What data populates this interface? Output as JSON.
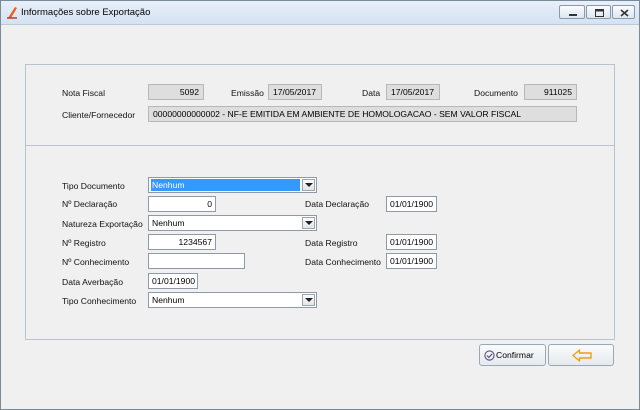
{
  "window": {
    "title": "Informações sobre Exportação",
    "controls": [
      "minimize-icon",
      "maximize-icon",
      "close-icon"
    ]
  },
  "invoice": {
    "nota_fiscal_label": "Nota Fiscal",
    "nota_fiscal_value": "5092",
    "emissao_label": "Emissão",
    "emissao_value": "17/05/2017",
    "data_label": "Data",
    "data_value": "17/05/2017",
    "documento_label": "Documento",
    "documento_value": "911025",
    "cliente_label": "Cliente/Fornecedor",
    "cliente_value": "00000000000002 - NF-E EMITIDA EM AMBIENTE DE HOMOLOGACAO - SEM VALOR FISCAL"
  },
  "export": {
    "tipo_documento_label": "Tipo Documento",
    "tipo_documento_value": "Nenhum",
    "num_declaracao_label": "Nº Declaração",
    "num_declaracao_value": "0",
    "data_declaracao_label": "Data Declaração",
    "data_declaracao_value": "01/01/1900",
    "natureza_label": "Natureza Exportação",
    "natureza_value": "Nenhum",
    "num_registro_label": "Nº Registro",
    "num_registro_value": "1234567",
    "data_registro_label": "Data Registro",
    "data_registro_value": "01/01/1900",
    "num_conhecimento_label": "Nº Conhecimento",
    "num_conhecimento_value": "",
    "data_conhecimento_label": "Data Conhecimento",
    "data_conhecimento_value": "01/01/1900",
    "data_averbacao_label": "Data Averbação",
    "data_averbacao_value": "01/01/1900",
    "tipo_conhecimento_label": "Tipo Conhecimento",
    "tipo_conhecimento_value": "Nenhum"
  },
  "actions": {
    "confirm_label": "Confirmar",
    "confirm_icon": "check-circle-icon",
    "back_icon": "arrow-left-icon",
    "accent_color": "#f39c12"
  }
}
